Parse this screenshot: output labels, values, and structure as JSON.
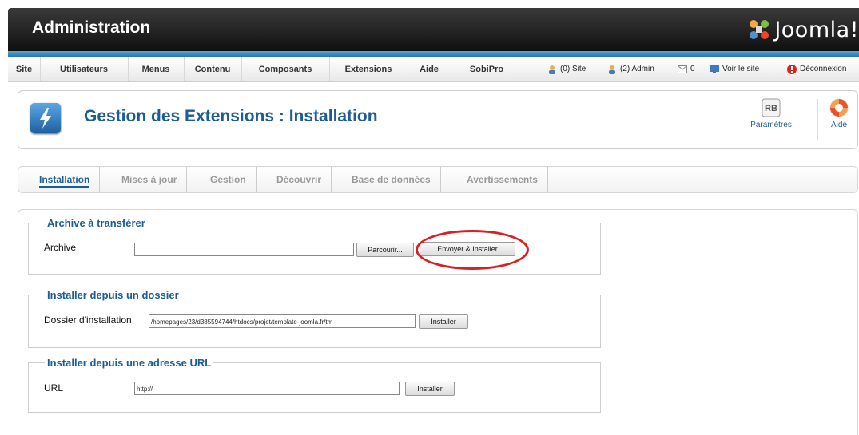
{
  "header": {
    "title": "Administration",
    "logo_text": "Joomla!"
  },
  "menu": {
    "items": [
      "Site",
      "Utilisateurs",
      "Menus",
      "Contenu",
      "Composants",
      "Extensions",
      "Aide",
      "SobiPro"
    ],
    "status": {
      "site_users": "(0) Site",
      "admin_users": "(2) Admin",
      "messages": "0",
      "view_site": "Voir le site",
      "logout": "Déconnexion"
    }
  },
  "toolbar": {
    "title": "Gestion des Extensions : Installation",
    "params_label": "Paramètres",
    "help_label": "Aide",
    "params_icon_text": "RB"
  },
  "tabs": [
    "Installation",
    "Mises à jour",
    "Gestion",
    "Découvrir",
    "Base de données",
    "Avertissements"
  ],
  "active_tab": "Installation",
  "upload": {
    "legend": "Archive à transférer",
    "label": "Archive",
    "value": "",
    "browse_label": "Parcourir...",
    "submit_label": "Envoyer & Installer"
  },
  "folder": {
    "legend": "Installer depuis un dossier",
    "label": "Dossier d'installation",
    "value": "/homepages/23/d385594744/htdocs/projet/template-joomla.fr/tm",
    "button_label": "Installer"
  },
  "url": {
    "legend": "Installer depuis une adresse URL",
    "label": "URL",
    "value": "http://",
    "button_label": "Installer"
  },
  "colors": {
    "accent": "#1d5d96",
    "highlight": "#dd1e22",
    "header": "#1a1a1a"
  }
}
